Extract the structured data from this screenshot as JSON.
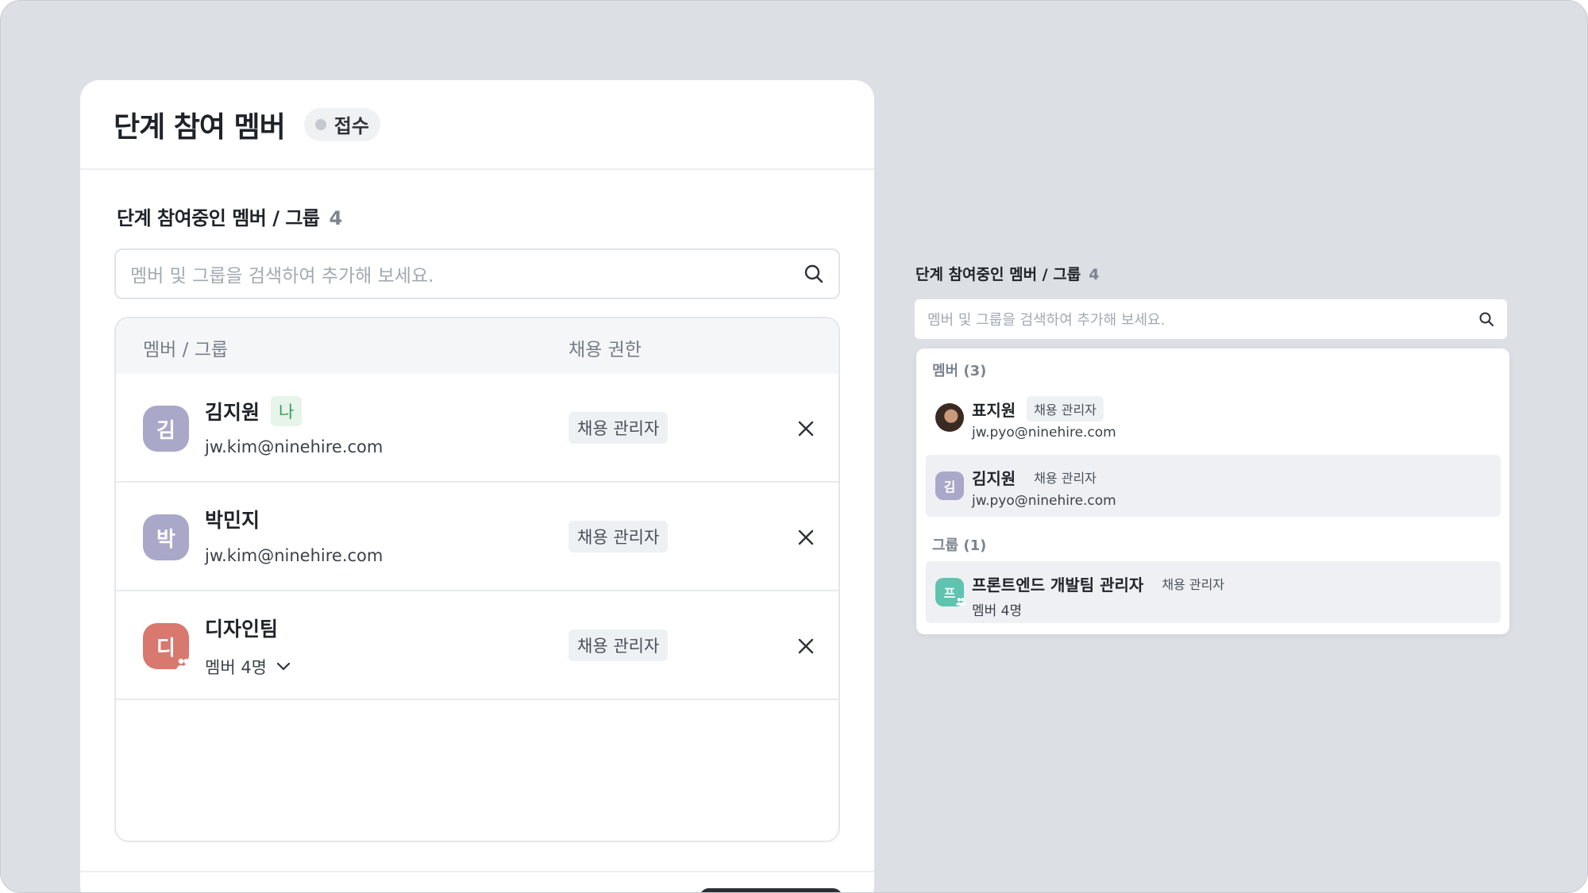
{
  "modal": {
    "title": "단계 참여 멤버",
    "status": "접수",
    "section_title": "단계 참여중인 멤버 / 그룹",
    "section_count": "4",
    "search_placeholder": "멤버 및 그룹을 검색하여 추가해 보세요.",
    "columns": {
      "member": "멤버 / 그룹",
      "permission": "채용 권한"
    },
    "rows": [
      {
        "initial": "김",
        "name": "김지원",
        "tag": "나",
        "sub": "jw.kim@ninehire.com",
        "permission": "채용 관리자"
      },
      {
        "initial": "박",
        "name": "박민지",
        "sub": "jw.kim@ninehire.com",
        "permission": "채용 관리자"
      },
      {
        "initial": "디",
        "name": "디자인팀",
        "sub": "멤버 4명",
        "permission": "채용 관리자"
      }
    ]
  },
  "preview": {
    "section_title": "단계 참여중인 멤버 / 그룹",
    "section_count": "4",
    "search_placeholder": "멤버 및 그룹을 검색하여 추가해 보세요.",
    "members_header": "멤버 (3)",
    "groups_header": "그룹 (1)",
    "members": [
      {
        "name": "표지원",
        "permission": "채용 관리자",
        "email": "jw.pyo@ninehire.com"
      },
      {
        "initial": "김",
        "name": "김지원",
        "permission": "채용 관리자",
        "email": "jw.pyo@ninehire.com"
      }
    ],
    "groups": [
      {
        "initial": "프",
        "name": "프론트엔드 개발팀 관리자",
        "permission": "채용 관리자",
        "sub": "멤버 4명"
      }
    ]
  },
  "colors": {
    "background": "#dcdfe3",
    "avatar_purple": "#a9a8c9",
    "avatar_red": "#d8786e",
    "avatar_teal": "#5fc3b0",
    "me_tag": "#e6f4ea"
  }
}
